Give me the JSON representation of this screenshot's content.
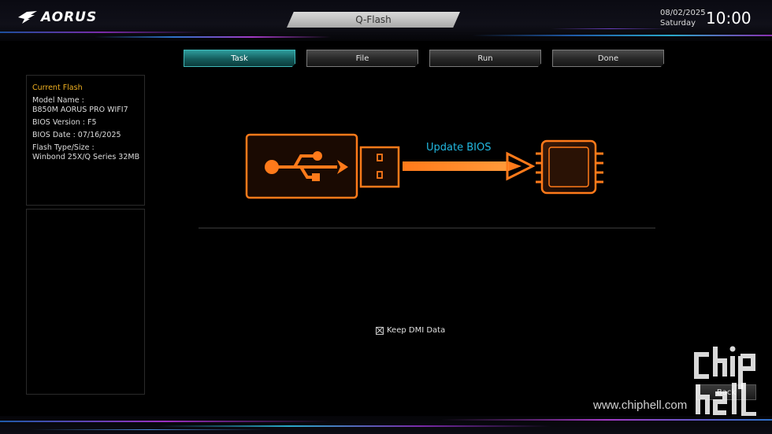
{
  "header": {
    "brand": "AORUS",
    "title": "Q-Flash",
    "date": "08/02/2025",
    "day": "Saturday",
    "time": "10:00"
  },
  "tabs": [
    {
      "label": "Task",
      "active": true
    },
    {
      "label": "File",
      "active": false
    },
    {
      "label": "Run",
      "active": false
    },
    {
      "label": "Done",
      "active": false
    }
  ],
  "current_flash": {
    "heading": "Current Flash",
    "model_label": "Model Name :",
    "model_value": "B850M AORUS PRO WIFI7",
    "bios_version": "BIOS Version : F5",
    "bios_date": "BIOS Date : 07/16/2025",
    "flash_type_label": "Flash Type/Size :",
    "flash_type_value": "Winbond 25X/Q Series  32MB"
  },
  "diagram": {
    "label": "Update BIOS",
    "usb_icon": "usb-icon",
    "chip_icon": "bios-chip-icon"
  },
  "options": {
    "keep_dmi_label": "Keep DMI Data",
    "keep_dmi_checked": true
  },
  "buttons": {
    "back_label": "Back"
  },
  "watermark": {
    "url": "www.chiphell.com"
  },
  "colors": {
    "accent_orange": "#ff7a1a",
    "accent_teal": "#2e9c9c",
    "label_blue": "#22b8e0",
    "heading_gold": "#f0b020"
  }
}
